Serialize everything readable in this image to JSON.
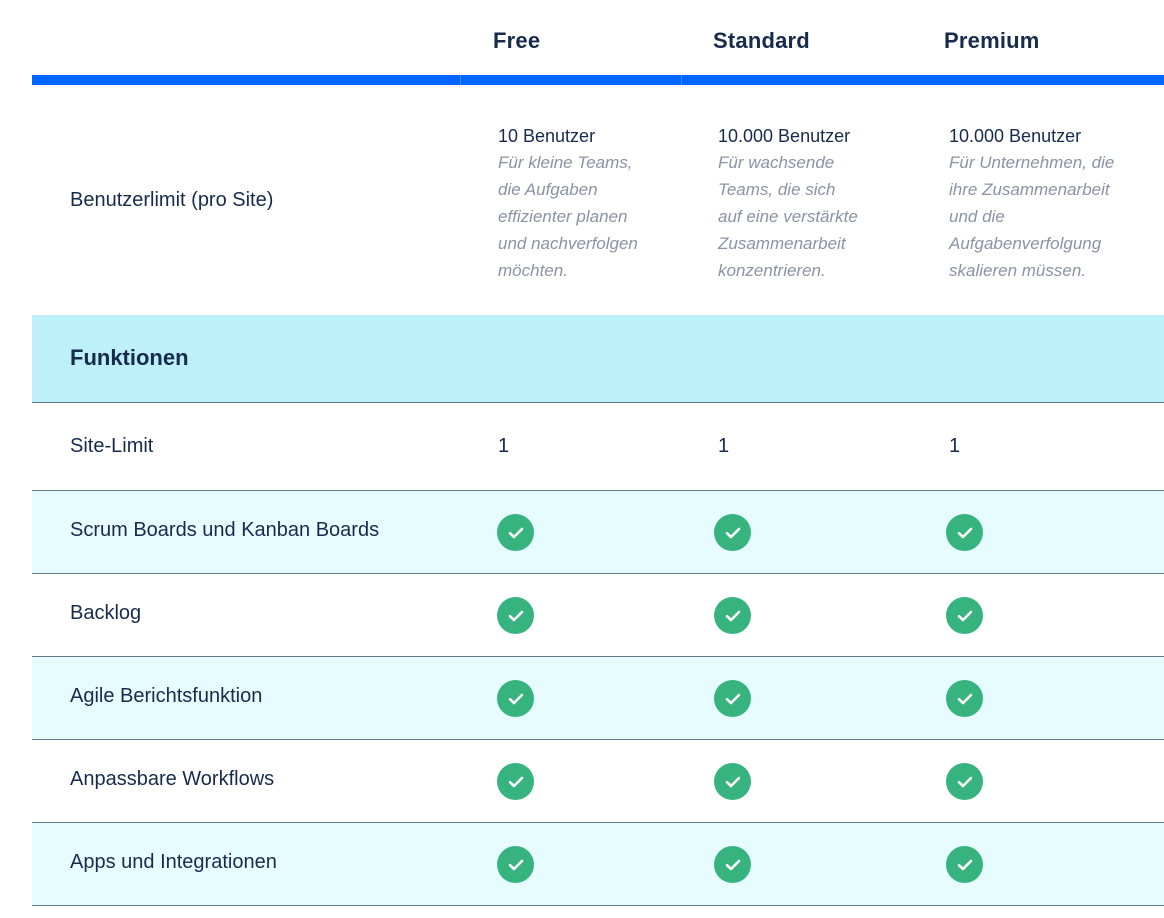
{
  "plans": [
    "Free",
    "Standard",
    "Premium"
  ],
  "user_limit": {
    "label": "Benutzerlimit (pro Site)",
    "cells": [
      {
        "count": "10 Benutzer",
        "desc": "Für kleine Teams,\ndie Aufgaben\neffizienter planen\nund nachverfolgen\nmöchten."
      },
      {
        "count": "10.000 Benutzer",
        "desc": "Für wachsende\nTeams, die sich\nauf eine verstärkte\nZusammenarbeit\nkonzentrieren."
      },
      {
        "count": "10.000 Benutzer",
        "desc": "Für Unternehmen, die\nihre Zusammenarbeit\nund die\nAufgabenverfolgung\nskalieren müssen."
      }
    ]
  },
  "section": {
    "label": "Funktionen"
  },
  "site_limit": {
    "label": "Site-Limit",
    "values": [
      "1",
      "1",
      "1"
    ]
  },
  "features": [
    {
      "label": "Scrum Boards und Kanban Boards",
      "included": [
        true,
        true,
        true
      ]
    },
    {
      "label": "Backlog",
      "included": [
        true,
        true,
        true
      ]
    },
    {
      "label": "Agile Berichtsfunktion",
      "included": [
        true,
        true,
        true
      ]
    },
    {
      "label": "Anpassbare Workflows",
      "included": [
        true,
        true,
        true
      ]
    },
    {
      "label": "Apps und Integrationen",
      "included": [
        true,
        true,
        true
      ]
    }
  ],
  "colors": {
    "header_bar": "#0065ff",
    "section_bg": "#bdf0f8",
    "alt_row_bg": "#e6fcff",
    "check": "#36b37e",
    "text": "#172b4d",
    "muted": "#8993a4"
  },
  "icons": {
    "included": "check-circle-icon"
  }
}
